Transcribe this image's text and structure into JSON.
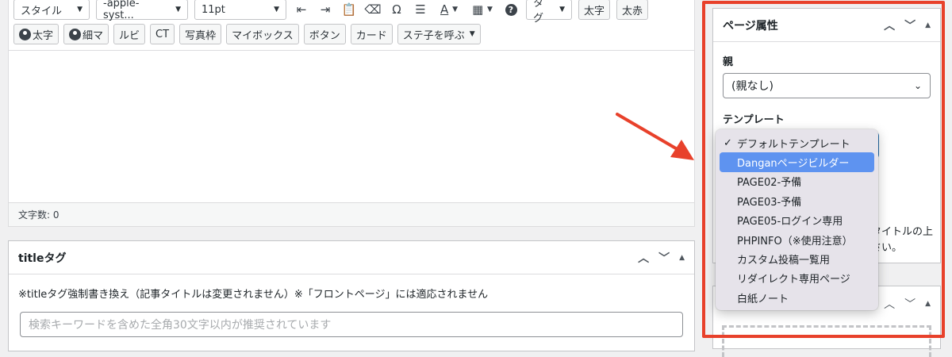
{
  "toolbar": {
    "style_select": "スタイル",
    "font_select": "-apple-syst...",
    "size_select": "11pt",
    "tag_select": "タグ",
    "bold_btn": "太字",
    "bold_red_btn": "太赤",
    "row2": {
      "bold_person": "太字",
      "fine_person": "細マ",
      "ruby": "ルビ",
      "ct": "CT",
      "photo_frame": "写真枠",
      "my_box": "マイボックス",
      "button": "ボタン",
      "card": "カード",
      "call_parts": "ステ子を呼ぶ"
    },
    "icons": [
      "indent-icon",
      "outdent-icon",
      "paste-icon",
      "eraser-icon",
      "omega-icon",
      "hr-icon",
      "text-color-icon",
      "table-icon",
      "help-icon"
    ]
  },
  "editor": {
    "char_count": "文字数: 0"
  },
  "title_box": {
    "title": "titleタグ",
    "note": "※titleタグ強制書き換え（記事タイトルは変更されません）※「フロントページ」には適応されません",
    "placeholder": "検索キーワードを含めた全角30文字以内が推奨されています"
  },
  "page_attributes": {
    "title": "ページ属性",
    "parent_label": "親",
    "parent_value": "(親なし)",
    "template_label": "テンプレート",
    "help_line1": "タイトルの上",
    "help_line2": "さい。"
  },
  "template_dropdown": {
    "check_mark": "✓",
    "items": [
      "デフォルトテンプレート",
      "Danganページビルダー",
      "PAGE02-予備",
      "PAGE03-予備",
      "PAGE05-ログイン専用",
      "PHPINFO（※使用注意）",
      "カスタム投稿一覧用",
      "リダイレクト専用ページ",
      "白紙ノート"
    ]
  },
  "colors": {
    "highlight_frame": "#e8412b",
    "arrow": "#e8412b",
    "selected_item": "#5e93f0",
    "focus_border": "#2271b1"
  }
}
